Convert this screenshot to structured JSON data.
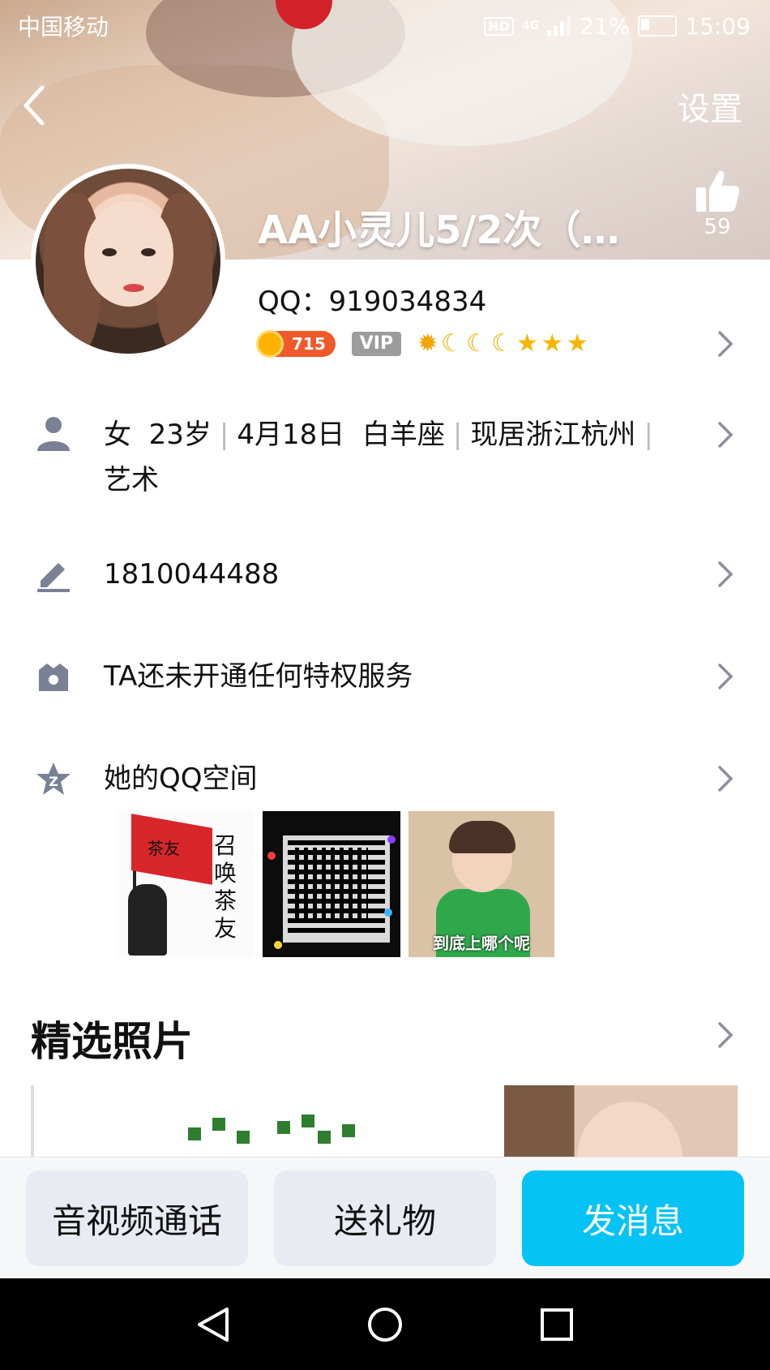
{
  "status_bar": {
    "carrier": "中国移动",
    "hd": "HD",
    "network": "4G",
    "battery": "21%",
    "time": "15:09"
  },
  "header": {
    "settings_label": "设置",
    "like_count": "59"
  },
  "profile": {
    "nickname": "AA小灵儿5/2次（…",
    "qq_label": "QQ：919034834",
    "coin_level": "715",
    "vip_label": "VIP",
    "level_icons": [
      "sun",
      "moon",
      "moon",
      "moon",
      "star",
      "star",
      "star"
    ]
  },
  "info": {
    "gender": "女",
    "age": "23岁",
    "birthday": "4月18日",
    "zodiac": "白羊座",
    "location": "现居浙江杭州",
    "occupation": "艺术"
  },
  "signature": {
    "text": "1810044488"
  },
  "privilege": {
    "text": "TA还未开通任何特权服务"
  },
  "qzone": {
    "title": "她的QQ空间",
    "thumb1_text": "召唤茶友",
    "thumb1_flag": "茶友",
    "thumb3_caption": "到底上哪个呢"
  },
  "featured": {
    "title": "精选照片"
  },
  "actions": {
    "call": "音视频通话",
    "gift": "送礼物",
    "message": "发消息"
  },
  "colors": {
    "accent": "#06c3f5",
    "coin": "#f05a2a",
    "vip": "#9c9c9c"
  }
}
